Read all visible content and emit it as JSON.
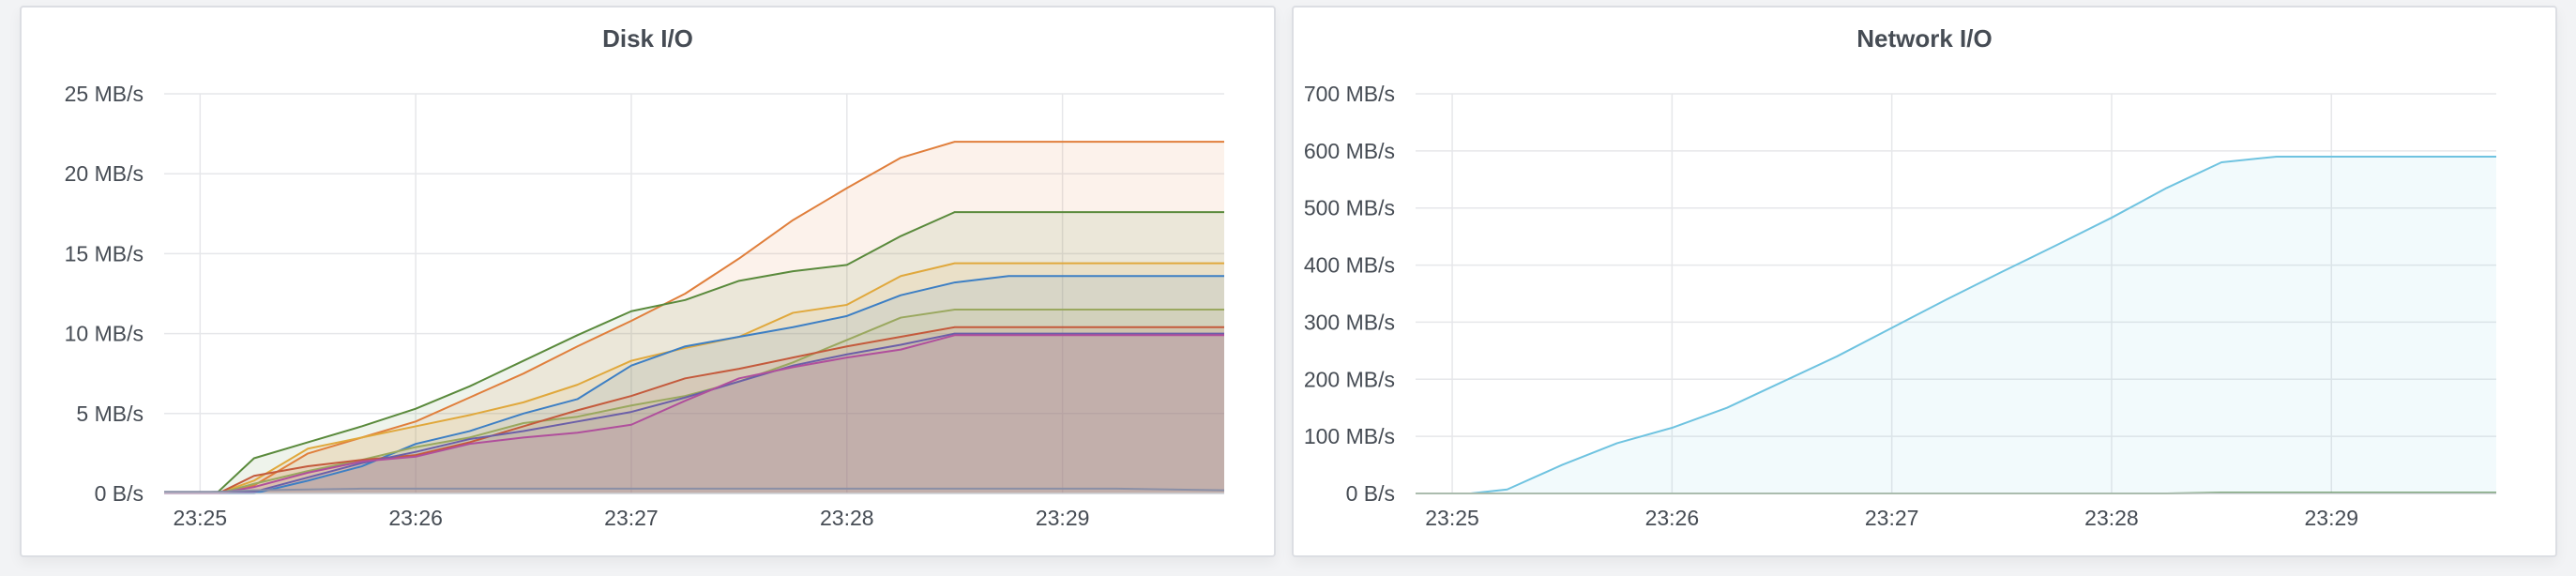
{
  "colors": {
    "grid": "#e6e7ea",
    "axis_text": "#464c54",
    "panel_border": "#dcdee3"
  },
  "chart_data": [
    {
      "type": "area",
      "title": "Disk I/O",
      "xlabel": "",
      "ylabel": "",
      "x_ticks": [
        "23:25",
        "23:26",
        "23:27",
        "23:28",
        "23:29"
      ],
      "y_ticks": [
        "0 B/s",
        "5 MB/s",
        "10 MB/s",
        "15 MB/s",
        "20 MB/s",
        "25 MB/s"
      ],
      "xlim": [
        "23:24:50",
        "23:29:45"
      ],
      "ylim": [
        0,
        25
      ],
      "y_unit": "MB/s",
      "grid": true,
      "legend": "none",
      "x": [
        "23:24:50",
        "23:25:05",
        "23:25:15",
        "23:25:30",
        "23:25:45",
        "23:26:00",
        "23:26:15",
        "23:26:30",
        "23:26:45",
        "23:27:00",
        "23:27:15",
        "23:27:30",
        "23:27:45",
        "23:28:00",
        "23:28:15",
        "23:28:30",
        "23:28:45",
        "23:29:00",
        "23:29:15",
        "23:29:30",
        "23:29:45"
      ],
      "series": [
        {
          "color": "#e07f3c",
          "fill": true,
          "values": [
            0,
            0,
            0.5,
            2.5,
            3.5,
            4.5,
            6,
            7.5,
            9.2,
            10.8,
            12.5,
            14.7,
            17.1,
            19.1,
            21,
            22,
            22,
            22,
            22,
            22,
            22
          ]
        },
        {
          "color": "#5a8a3c",
          "fill": true,
          "values": [
            0,
            0.1,
            2.2,
            3.2,
            4.2,
            5.3,
            6.7,
            8.3,
            9.9,
            11.4,
            12.1,
            13.3,
            13.9,
            14.3,
            16.1,
            17.6,
            17.6,
            17.6,
            17.6,
            17.6,
            17.6
          ]
        },
        {
          "color": "#e0a83c",
          "fill": true,
          "values": [
            0,
            0,
            0.8,
            2.8,
            3.5,
            4.2,
            4.9,
            5.7,
            6.8,
            8.3,
            9.1,
            9.8,
            11.3,
            11.8,
            13.6,
            14.4,
            14.4,
            14.4,
            14.4,
            14.4,
            14.4
          ]
        },
        {
          "color": "#3d7fc4",
          "fill": true,
          "values": [
            0,
            0,
            0,
            0.8,
            1.7,
            3.1,
            3.9,
            5,
            5.9,
            8,
            9.2,
            9.8,
            10.4,
            11.1,
            12.4,
            13.2,
            13.6,
            13.6,
            13.6,
            13.6,
            13.6
          ]
        },
        {
          "color": "#9aa85f",
          "fill": true,
          "values": [
            0,
            0,
            0.6,
            1.4,
            2.1,
            2.9,
            3.5,
            4.4,
            4.8,
            5.5,
            6.1,
            7,
            8.2,
            9.6,
            11,
            11.5,
            11.5,
            11.5,
            11.5,
            11.5,
            11.5
          ]
        },
        {
          "color": "#c45a3c",
          "fill": true,
          "values": [
            0,
            0,
            1.1,
            1.7,
            2.1,
            2.4,
            3.2,
            4.2,
            5.2,
            6.1,
            7.2,
            7.8,
            8.5,
            9.2,
            9.8,
            10.4,
            10.4,
            10.4,
            10.4,
            10.4,
            10.4
          ]
        },
        {
          "color": "#6b5fa8",
          "fill": true,
          "values": [
            0,
            0,
            0.1,
            1,
            1.9,
            2.6,
            3.4,
            3.9,
            4.5,
            5.1,
            6,
            7,
            8,
            8.7,
            9.3,
            10,
            10,
            10,
            10,
            10,
            10
          ]
        },
        {
          "color": "#b04f9c",
          "fill": true,
          "values": [
            0,
            0,
            0.4,
            1.3,
            2,
            2.3,
            3.1,
            3.5,
            3.8,
            4.3,
            5.8,
            7.2,
            7.9,
            8.5,
            9,
            9.9,
            9.9,
            9.9,
            9.9,
            9.9,
            9.9
          ]
        },
        {
          "color": "#8a8fa6",
          "fill": false,
          "values": [
            0.1,
            0.1,
            0.2,
            0.25,
            0.3,
            0.3,
            0.3,
            0.3,
            0.3,
            0.3,
            0.3,
            0.3,
            0.3,
            0.3,
            0.3,
            0.3,
            0.3,
            0.3,
            0.3,
            0.25,
            0.2
          ]
        }
      ]
    },
    {
      "type": "area",
      "title": "Network I/O",
      "xlabel": "",
      "ylabel": "",
      "x_ticks": [
        "23:25",
        "23:26",
        "23:27",
        "23:28",
        "23:29"
      ],
      "y_ticks": [
        "0 B/s",
        "100 MB/s",
        "200 MB/s",
        "300 MB/s",
        "400 MB/s",
        "500 MB/s",
        "600 MB/s",
        "700 MB/s"
      ],
      "xlim": [
        "23:24:50",
        "23:29:45"
      ],
      "ylim": [
        0,
        700
      ],
      "y_unit": "MB/s",
      "grid": true,
      "legend": "none",
      "x": [
        "23:24:50",
        "23:25:05",
        "23:25:15",
        "23:25:30",
        "23:25:45",
        "23:26:00",
        "23:26:15",
        "23:26:30",
        "23:26:45",
        "23:27:00",
        "23:27:15",
        "23:27:30",
        "23:27:45",
        "23:28:00",
        "23:28:15",
        "23:28:30",
        "23:28:45",
        "23:29:00",
        "23:29:15",
        "23:29:30",
        "23:29:45"
      ],
      "series": [
        {
          "color": "#6fc3e0",
          "fill": true,
          "values": [
            0,
            0,
            7,
            50,
            88,
            115,
            150,
            195,
            240,
            290,
            340,
            388,
            435,
            483,
            535,
            580,
            590,
            590,
            590,
            590,
            590
          ]
        },
        {
          "color": "#3e7a35",
          "fill": false,
          "values": [
            0,
            0,
            0,
            0,
            0,
            0,
            0,
            0,
            0,
            0,
            0,
            0,
            0,
            0,
            0,
            1,
            1,
            1,
            1,
            1,
            1
          ]
        }
      ]
    }
  ]
}
